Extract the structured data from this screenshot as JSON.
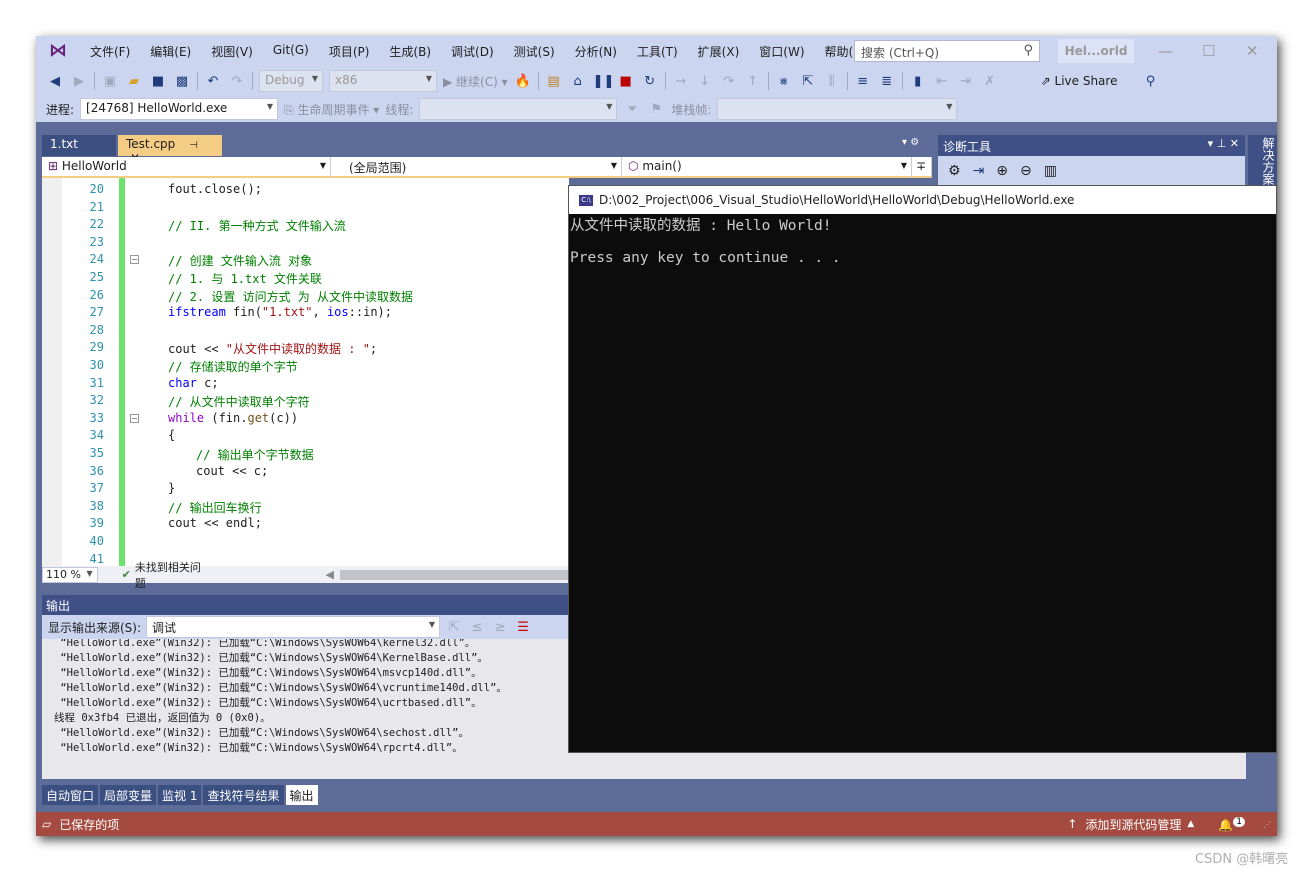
{
  "menu": {
    "items": [
      "文件(F)",
      "编辑(E)",
      "视图(V)",
      "Git(G)",
      "项目(P)",
      "生成(B)",
      "调试(D)",
      "测试(S)",
      "分析(N)",
      "工具(T)",
      "扩展(X)",
      "窗口(W)",
      "帮助(H)"
    ],
    "search_placeholder": "搜索 (Ctrl+Q)",
    "solution_title": "Hel...orld"
  },
  "toolbar": {
    "config": "Debug",
    "platform": "x86",
    "continue": "继续(C)",
    "live_share": "Live Share"
  },
  "debugbar": {
    "process_label": "进程:",
    "process_value": "[24768] HelloWorld.exe",
    "lifecycle": "生命周期事件",
    "thread_label": "线程:",
    "stack_label": "堆栈帧:"
  },
  "tabs": [
    {
      "label": "1.txt"
    },
    {
      "label": "Test.cpp",
      "active": true
    }
  ],
  "navbar": {
    "project": "HelloWorld",
    "scope": "(全局范围)",
    "member": "main()"
  },
  "editor": {
    "lines": [
      {
        "n": "20",
        "indent": 0,
        "tokens": [
          [
            "tx",
            "fout.close();"
          ]
        ]
      },
      {
        "n": "21",
        "indent": 0,
        "tokens": []
      },
      {
        "n": "22",
        "indent": 0,
        "tokens": [
          [
            "cm",
            "// II. 第一种方式 文件输入流"
          ]
        ]
      },
      {
        "n": "23",
        "indent": 0,
        "tokens": []
      },
      {
        "n": "24",
        "indent": 0,
        "tokens": [
          [
            "cm",
            "// 创建 文件输入流 对象"
          ]
        ],
        "fold": true
      },
      {
        "n": "25",
        "indent": 0,
        "tokens": [
          [
            "cm",
            "// 1. 与 1.txt 文件关联"
          ]
        ]
      },
      {
        "n": "26",
        "indent": 0,
        "tokens": [
          [
            "cm",
            "// 2. 设置 访问方式 为 从文件中读取数据"
          ]
        ]
      },
      {
        "n": "27",
        "indent": 0,
        "tokens": [
          [
            "kw",
            "ifstream"
          ],
          [
            "tx",
            " fin("
          ],
          [
            "str",
            "\"1.txt\""
          ],
          [
            "tx",
            ", "
          ],
          [
            "kw",
            "ios"
          ],
          [
            "tx",
            "::in);"
          ]
        ]
      },
      {
        "n": "28",
        "indent": 0,
        "tokens": []
      },
      {
        "n": "29",
        "indent": 0,
        "tokens": [
          [
            "tx",
            "cout << "
          ],
          [
            "str",
            "\"从文件中读取的数据 : \""
          ],
          [
            "tx",
            ";"
          ]
        ]
      },
      {
        "n": "30",
        "indent": 0,
        "tokens": [
          [
            "cm",
            "// 存储读取的单个字节"
          ]
        ]
      },
      {
        "n": "31",
        "indent": 0,
        "tokens": [
          [
            "kw",
            "char"
          ],
          [
            "tx",
            " c;"
          ]
        ]
      },
      {
        "n": "32",
        "indent": 0,
        "tokens": [
          [
            "cm",
            "// 从文件中读取单个字符"
          ]
        ]
      },
      {
        "n": "33",
        "indent": 0,
        "tokens": [
          [
            "ctl",
            "while"
          ],
          [
            "tx",
            " (fin."
          ],
          [
            "fn",
            "get"
          ],
          [
            "tx",
            "(c))"
          ]
        ],
        "fold": true
      },
      {
        "n": "34",
        "indent": 0,
        "tokens": [
          [
            "tx",
            "{"
          ]
        ]
      },
      {
        "n": "35",
        "indent": 1,
        "tokens": [
          [
            "cm",
            "// 输出单个字节数据"
          ]
        ]
      },
      {
        "n": "36",
        "indent": 1,
        "tokens": [
          [
            "tx",
            "cout << c;"
          ]
        ]
      },
      {
        "n": "37",
        "indent": 0,
        "tokens": [
          [
            "tx",
            "}"
          ]
        ]
      },
      {
        "n": "38",
        "indent": 0,
        "tokens": [
          [
            "cm",
            "// 输出回车换行"
          ]
        ]
      },
      {
        "n": "39",
        "indent": 0,
        "tokens": [
          [
            "tx",
            "cout << endl;"
          ]
        ]
      },
      {
        "n": "40",
        "indent": 0,
        "tokens": []
      },
      {
        "n": "41",
        "indent": 0,
        "tokens": []
      }
    ],
    "zoom": "110 %",
    "issues": "未找到相关问题"
  },
  "output": {
    "title": "输出",
    "source_label": "显示输出来源(S):",
    "source_value": "调试",
    "lines": [
      " “HelloWorld.exe”(Win32): 已加载“C:\\Windows\\SysWOW64\\kernel32.dll”。",
      " “HelloWorld.exe”(Win32): 已加载“C:\\Windows\\SysWOW64\\KernelBase.dll”。",
      " “HelloWorld.exe”(Win32): 已加载“C:\\Windows\\SysWOW64\\msvcp140d.dll”。",
      " “HelloWorld.exe”(Win32): 已加载“C:\\Windows\\SysWOW64\\vcruntime140d.dll”。",
      " “HelloWorld.exe”(Win32): 已加载“C:\\Windows\\SysWOW64\\ucrtbased.dll”。",
      "线程 0x3fb4 已退出，返回值为 0 (0x0)。",
      " “HelloWorld.exe”(Win32): 已加载“C:\\Windows\\SysWOW64\\sechost.dll”。",
      " “HelloWorld.exe”(Win32): 已加载“C:\\Windows\\SysWOW64\\rpcrt4.dll”。"
    ]
  },
  "bottom_tabs": [
    "自动窗口",
    "局部变量",
    "监视 1",
    "查找符号结果",
    "输出"
  ],
  "diagnostics": {
    "title": "诊断工具"
  },
  "solution_strip": "解决方案",
  "statusbar": {
    "left": "已保存的项",
    "right": "添加到源代码管理",
    "notifications": "1",
    "color": "#a54a40"
  },
  "console": {
    "title": "D:\\002_Project\\006_Visual_Studio\\HelloWorld\\HelloWorld\\Debug\\HelloWorld.exe",
    "lines": [
      "从文件中读取的数据 : Hello World!",
      "",
      "Press any key to continue . . ."
    ]
  },
  "watermark": "CSDN @韩曙亮"
}
